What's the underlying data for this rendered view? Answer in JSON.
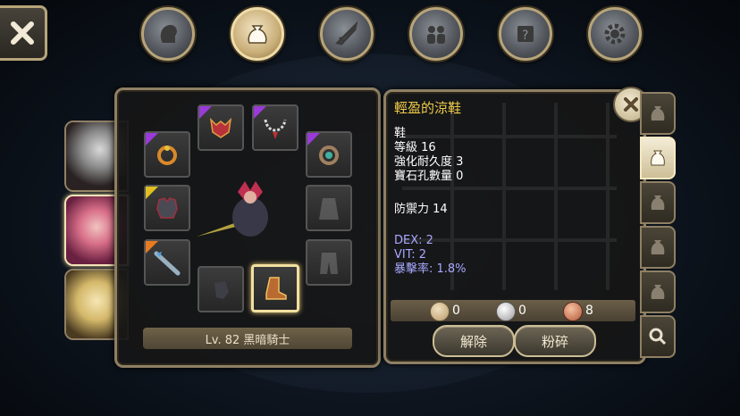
{
  "nav": {
    "icons": [
      "head-icon",
      "bag-icon",
      "sword-icon",
      "people-icon",
      "scroll-icon",
      "gear-icon"
    ],
    "active_index": 1
  },
  "character": {
    "level_label": "Lv. 82 黑暗騎士"
  },
  "item": {
    "name": "輕盈的涼鞋",
    "type": "鞋",
    "level": "等級 16",
    "durability": "強化耐久度 3",
    "gem_slots": "寶石孔數量 0",
    "defense": "防禦力 14",
    "dex": "DEX: 2",
    "vit": "VIT: 2",
    "crit": "暴擊率: 1.8%"
  },
  "currency": {
    "bronze": "0",
    "silver": "0",
    "copper": "8"
  },
  "buttons": {
    "unequip": "解除",
    "smash": "粉碎"
  },
  "colors": {
    "item_name": "#f0cc4a",
    "stat_bonus": "#a8a8ff",
    "panel_border": "#8f8064"
  }
}
